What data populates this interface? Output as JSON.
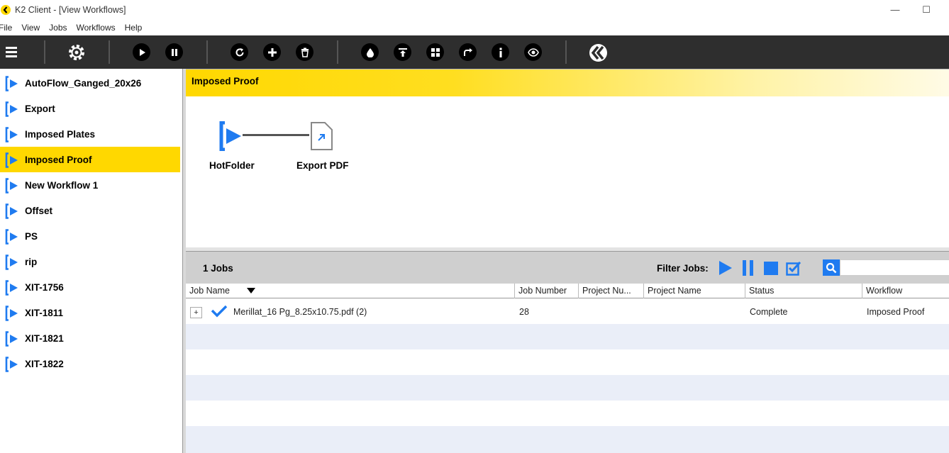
{
  "window": {
    "title": "K2 Client - [View Workflows]"
  },
  "menu": [
    "File",
    "View",
    "Jobs",
    "Workflows",
    "Help"
  ],
  "toolbar": {
    "buttons": [
      "menu-icon",
      "settings-icon",
      "play-icon",
      "pause-icon",
      "refresh-icon",
      "add-icon",
      "delete-icon",
      "ink-icon",
      "upload-icon",
      "layout-icon",
      "redirect-icon",
      "info-icon",
      "preview-icon",
      "k2-logo-icon"
    ]
  },
  "sidebar": {
    "items": [
      {
        "label": "AutoFlow_Ganged_20x26",
        "selected": false
      },
      {
        "label": "Export",
        "selected": false
      },
      {
        "label": "Imposed Plates",
        "selected": false
      },
      {
        "label": "Imposed Proof",
        "selected": true
      },
      {
        "label": "New Workflow 1",
        "selected": false
      },
      {
        "label": "Offset",
        "selected": false
      },
      {
        "label": "PS",
        "selected": false
      },
      {
        "label": "rip",
        "selected": false
      },
      {
        "label": "XIT-1756",
        "selected": false
      },
      {
        "label": "XIT-1811",
        "selected": false
      },
      {
        "label": "XIT-1821",
        "selected": false
      },
      {
        "label": "XIT-1822",
        "selected": false
      }
    ]
  },
  "workflow": {
    "title": "Imposed Proof",
    "nodes": [
      {
        "label": "HotFolder",
        "icon": "hotfolder-icon"
      },
      {
        "label": "Export PDF",
        "icon": "export-pdf-icon"
      }
    ]
  },
  "jobs": {
    "count_label": "1 Jobs",
    "filter_label": "Filter Jobs:",
    "filter_icons": [
      "filter-running-icon",
      "filter-paused-icon",
      "filter-stopped-icon",
      "filter-complete-icon"
    ],
    "search_value": "",
    "columns": [
      "Job Name",
      "Job Number",
      "Project Nu...",
      "Project Name",
      "Status",
      "Workflow"
    ],
    "rows": [
      {
        "expand": "+",
        "status_icon": "check-icon",
        "job_name": "Merillat_16 Pg_8.25x10.75.pdf (2)",
        "job_number": "28",
        "project_number": "",
        "project_name": "",
        "status": "Complete",
        "workflow": "Imposed Proof"
      }
    ]
  },
  "colors": {
    "accent": "#ffd800",
    "toolbar": "#2e2e2e",
    "blue": "#1f7bf0",
    "alt_row": "#eaeef8"
  }
}
